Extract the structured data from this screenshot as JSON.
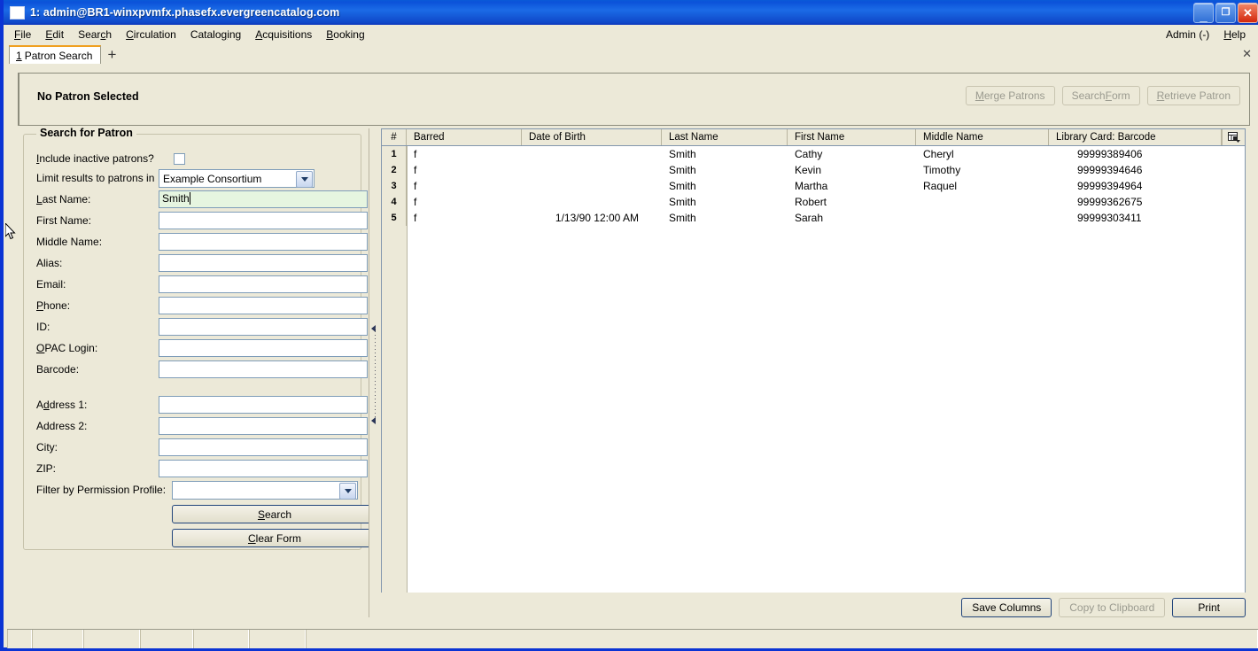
{
  "window": {
    "title": "1: admin@BR1-winxpvmfx.phasefx.evergreencatalog.com",
    "minimize_glyph": "_",
    "maximize_glyph": "❐",
    "close_glyph": "✕"
  },
  "menubar": {
    "items": [
      {
        "label": "File",
        "accel": "F"
      },
      {
        "label": "Edit",
        "accel": "E"
      },
      {
        "label": "Search",
        "accel": "c"
      },
      {
        "label": "Circulation",
        "accel": "C"
      },
      {
        "label": "Cataloging",
        "accel": "g"
      },
      {
        "label": "Acquisitions",
        "accel": "A"
      },
      {
        "label": "Booking",
        "accel": "B"
      }
    ],
    "right_items": [
      {
        "label": "Admin (-)"
      },
      {
        "label": "Help"
      }
    ]
  },
  "tabs": {
    "items": [
      {
        "index": "1",
        "label": "Patron Search"
      }
    ],
    "new_tab_glyph": "+",
    "close_glyph": "✕"
  },
  "patron_bar": {
    "status": "No Patron Selected",
    "buttons": [
      {
        "label": "Merge Patrons",
        "enabled": false
      },
      {
        "label": "Search Form",
        "enabled": false
      },
      {
        "label": "Retrieve Patron",
        "enabled": false
      }
    ]
  },
  "search_form": {
    "legend": "Search for Patron",
    "include_inactive": {
      "label": "Include inactive patrons?",
      "checked": false
    },
    "limit_results": {
      "label": "Limit results to patrons in",
      "value": "Example Consortium"
    },
    "fields": [
      {
        "label": "Last Name:",
        "value": "Smith",
        "focused": true
      },
      {
        "label": "First Name:",
        "value": ""
      },
      {
        "label": "Middle Name:",
        "value": ""
      },
      {
        "label": "Alias:",
        "value": ""
      },
      {
        "label": "Email:",
        "value": ""
      },
      {
        "label": "Phone:",
        "value": ""
      },
      {
        "label": "ID:",
        "value": ""
      },
      {
        "label": "OPAC Login:",
        "value": ""
      },
      {
        "label": "Barcode:",
        "value": ""
      }
    ],
    "address_fields": [
      {
        "label": "Address 1:",
        "value": ""
      },
      {
        "label": "Address 2:",
        "value": ""
      },
      {
        "label": "City:",
        "value": ""
      },
      {
        "label": "ZIP:",
        "value": ""
      }
    ],
    "permission_profile": {
      "label": "Filter by Permission Profile:",
      "value": ""
    },
    "search_button": "Search",
    "clear_button": "Clear Form"
  },
  "results": {
    "columns": [
      "#",
      "Barred",
      "Date of Birth",
      "Last Name",
      "First Name",
      "Middle Name",
      "Library Card: Barcode"
    ],
    "column_picker_icon": "column-picker-icon",
    "rows": [
      {
        "num": "1",
        "barred": "f",
        "dob": "",
        "last": "Smith",
        "first": "Cathy",
        "middle": "Cheryl",
        "barcode": "99999389406"
      },
      {
        "num": "2",
        "barred": "f",
        "dob": "",
        "last": "Smith",
        "first": "Kevin",
        "middle": "Timothy",
        "barcode": "99999394646"
      },
      {
        "num": "3",
        "barred": "f",
        "dob": "",
        "last": "Smith",
        "first": "Martha",
        "middle": "Raquel",
        "barcode": "99999394964"
      },
      {
        "num": "4",
        "barred": "f",
        "dob": "",
        "last": "Smith",
        "first": "Robert",
        "middle": "",
        "barcode": "99999362675"
      },
      {
        "num": "5",
        "barred": "f",
        "dob": "1/13/90 12:00 AM",
        "last": "Smith",
        "first": "Sarah",
        "middle": "",
        "barcode": "99999303411"
      }
    ],
    "buttons": [
      {
        "label": "Save Columns",
        "enabled": true
      },
      {
        "label": "Copy to Clipboard",
        "enabled": false
      },
      {
        "label": "Print",
        "enabled": true
      }
    ]
  },
  "colors": {
    "title_bar": "#0b52d9",
    "window_chrome": "#ece9d8",
    "focused_field": "#e6f5e0",
    "tab_accent": "#f0a020",
    "field_border": "#7f9db9",
    "button_border": "#21447a"
  }
}
